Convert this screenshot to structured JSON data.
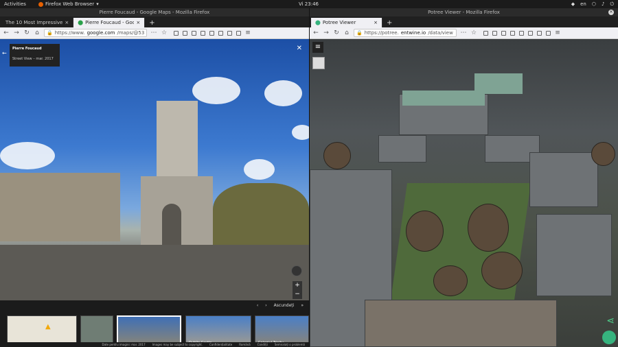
{
  "system": {
    "activities": "Activities",
    "app_name": "Firefox Web Browser",
    "clock": "Vi 23:46",
    "lang": "en"
  },
  "left_window": {
    "title": "Pierre Foucaud - Google Maps - Mozilla Firefox",
    "tabs": [
      {
        "label": "The 10 Most Impressive"
      },
      {
        "label": "Pierre Foucaud - Google"
      }
    ],
    "url": {
      "prefix": "https://www.",
      "host": "google.com",
      "rest": "/maps/@53"
    },
    "streetview": {
      "author": "Pierre Foucaud",
      "subtitle": "Street View – mar. 2017",
      "filmstrip_label": "Ascundeți",
      "thumbs": [
        {
          "label": "Dublin Castle"
        },
        {
          "label": "Colegiul Trinity"
        }
      ],
      "footer": [
        "Date pentru imagini: mar. 2017",
        "Images may be subject to copyright.",
        "Confidențialitate",
        "Română",
        "Condiții",
        "Semnalați o problemă"
      ]
    }
  },
  "right_window": {
    "title": "Potree Viewer - Mozilla Firefox",
    "tabs": [
      {
        "label": "Potree Viewer"
      }
    ],
    "url": {
      "prefix": "https://potree.",
      "host": "entwine.io",
      "rest": "/data/view"
    }
  }
}
